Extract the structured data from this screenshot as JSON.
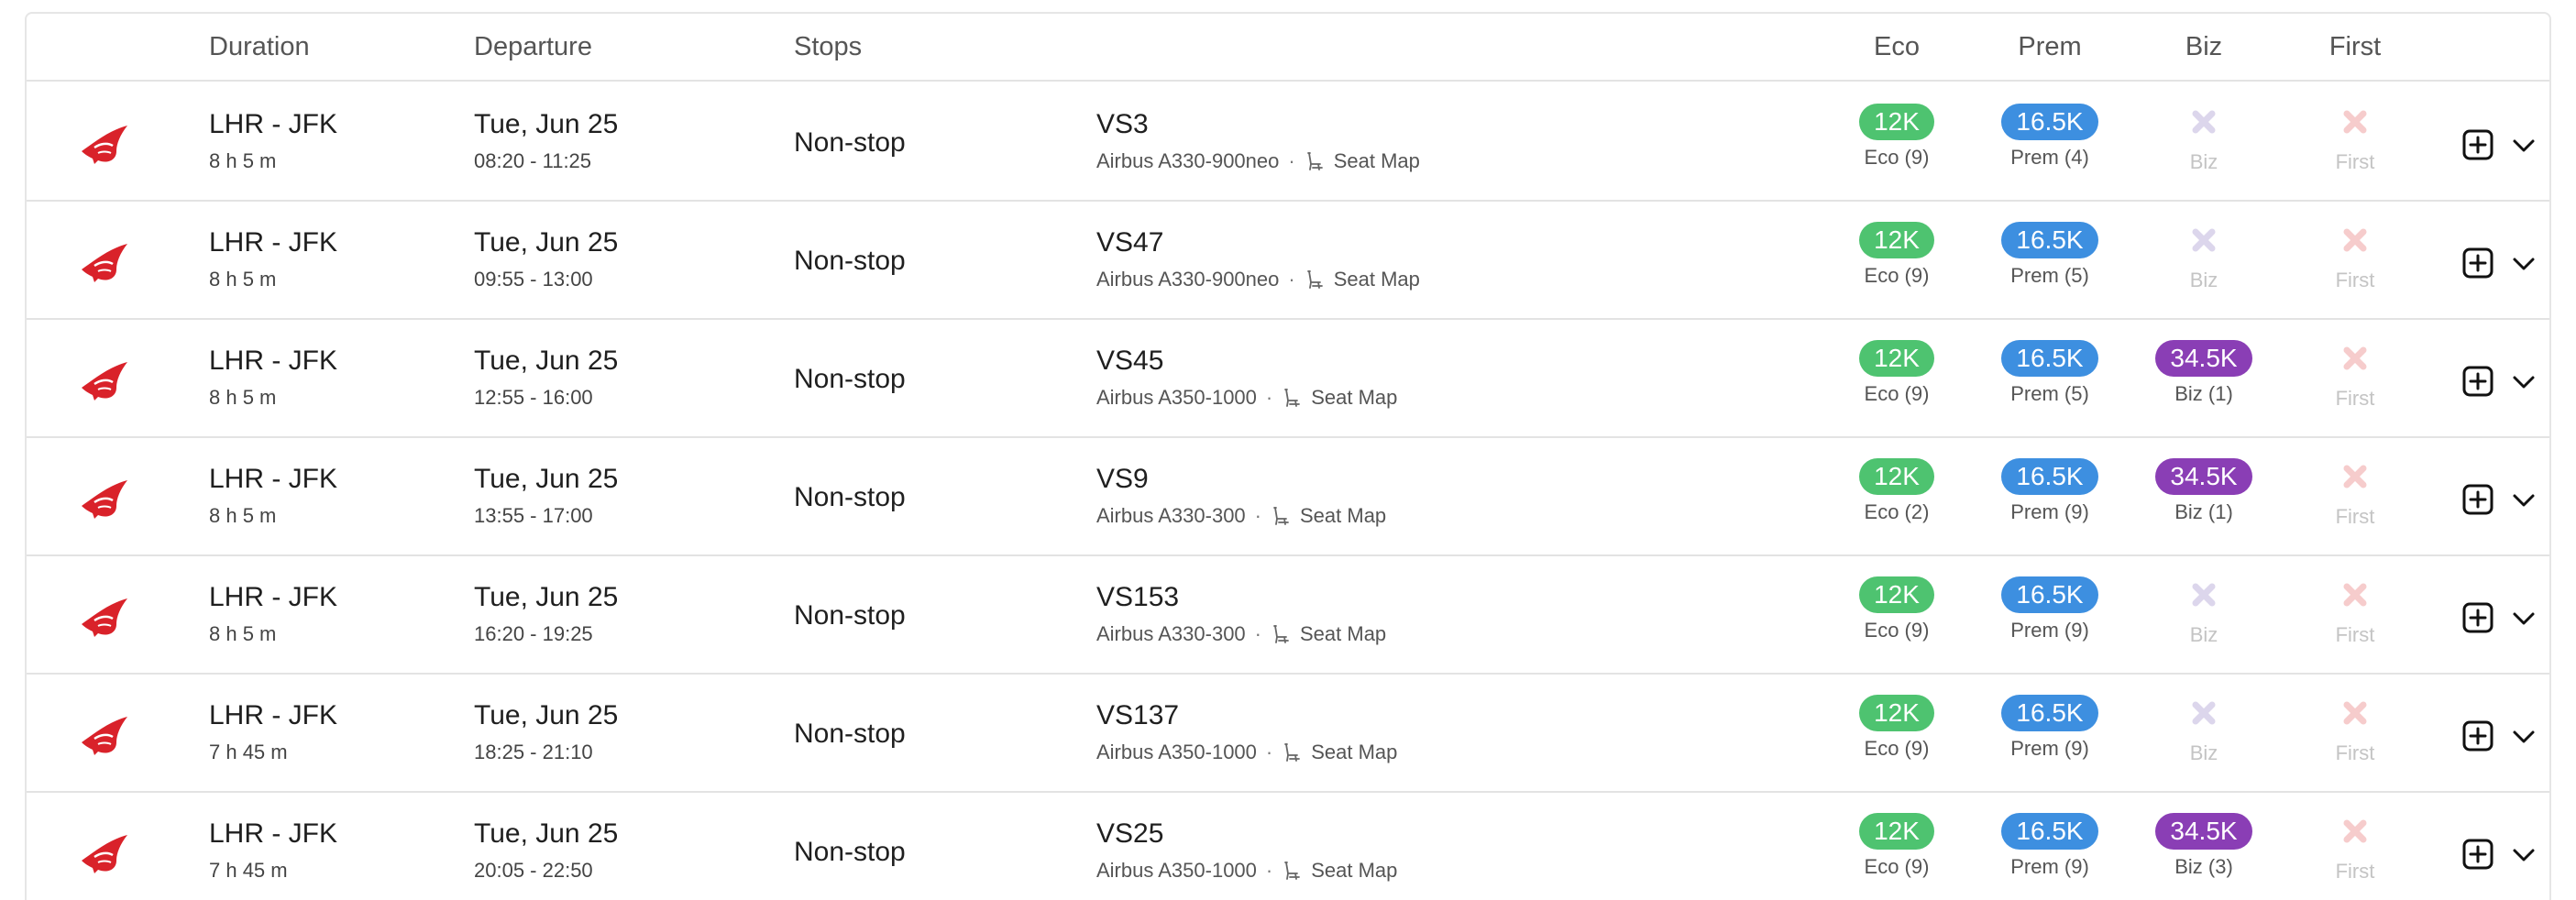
{
  "header": {
    "duration": "Duration",
    "departure": "Departure",
    "stops": "Stops",
    "eco": "Eco",
    "prem": "Prem",
    "biz": "Biz",
    "first": "First"
  },
  "colors": {
    "eco": "#4ec370",
    "prem": "#3d8fe0",
    "biz": "#8a3eb5",
    "airline_red": "#d9222a"
  },
  "icons": {
    "airline": "virgin-atlantic-logo",
    "seat": "seat-icon",
    "unavailable": "x-icon",
    "add": "plus-square-icon",
    "expand": "chevron-down-icon"
  },
  "rows": [
    {
      "route": "LHR - JFK",
      "duration": "8 h 5 m",
      "date": "Tue, Jun 25",
      "time": "08:20 - 11:25",
      "stops": "Non-stop",
      "flight": "VS3",
      "aircraft": "Airbus A330-900neo",
      "dot": "·",
      "seatmap": "Seat Map",
      "eco": {
        "price": "12K",
        "label": "Eco (9)",
        "available": true
      },
      "prem": {
        "price": "16.5K",
        "label": "Prem (4)",
        "available": true
      },
      "biz": {
        "price": "",
        "label": "Biz",
        "available": false
      },
      "first": {
        "price": "",
        "label": "First",
        "available": false
      }
    },
    {
      "route": "LHR - JFK",
      "duration": "8 h 5 m",
      "date": "Tue, Jun 25",
      "time": "09:55 - 13:00",
      "stops": "Non-stop",
      "flight": "VS47",
      "aircraft": "Airbus A330-900neo",
      "dot": "·",
      "seatmap": "Seat Map",
      "eco": {
        "price": "12K",
        "label": "Eco (9)",
        "available": true
      },
      "prem": {
        "price": "16.5K",
        "label": "Prem (5)",
        "available": true
      },
      "biz": {
        "price": "",
        "label": "Biz",
        "available": false
      },
      "first": {
        "price": "",
        "label": "First",
        "available": false
      }
    },
    {
      "route": "LHR - JFK",
      "duration": "8 h 5 m",
      "date": "Tue, Jun 25",
      "time": "12:55 - 16:00",
      "stops": "Non-stop",
      "flight": "VS45",
      "aircraft": "Airbus A350-1000",
      "dot": "·",
      "seatmap": "Seat Map",
      "eco": {
        "price": "12K",
        "label": "Eco (9)",
        "available": true
      },
      "prem": {
        "price": "16.5K",
        "label": "Prem (5)",
        "available": true
      },
      "biz": {
        "price": "34.5K",
        "label": "Biz (1)",
        "available": true
      },
      "first": {
        "price": "",
        "label": "First",
        "available": false
      }
    },
    {
      "route": "LHR - JFK",
      "duration": "8 h 5 m",
      "date": "Tue, Jun 25",
      "time": "13:55 - 17:00",
      "stops": "Non-stop",
      "flight": "VS9",
      "aircraft": "Airbus A330-300",
      "dot": "·",
      "seatmap": "Seat Map",
      "eco": {
        "price": "12K",
        "label": "Eco (2)",
        "available": true
      },
      "prem": {
        "price": "16.5K",
        "label": "Prem (9)",
        "available": true
      },
      "biz": {
        "price": "34.5K",
        "label": "Biz (1)",
        "available": true
      },
      "first": {
        "price": "",
        "label": "First",
        "available": false
      }
    },
    {
      "route": "LHR - JFK",
      "duration": "8 h 5 m",
      "date": "Tue, Jun 25",
      "time": "16:20 - 19:25",
      "stops": "Non-stop",
      "flight": "VS153",
      "aircraft": "Airbus A330-300",
      "dot": "·",
      "seatmap": "Seat Map",
      "eco": {
        "price": "12K",
        "label": "Eco (9)",
        "available": true
      },
      "prem": {
        "price": "16.5K",
        "label": "Prem (9)",
        "available": true
      },
      "biz": {
        "price": "",
        "label": "Biz",
        "available": false
      },
      "first": {
        "price": "",
        "label": "First",
        "available": false
      }
    },
    {
      "route": "LHR - JFK",
      "duration": "7 h 45 m",
      "date": "Tue, Jun 25",
      "time": "18:25 - 21:10",
      "stops": "Non-stop",
      "flight": "VS137",
      "aircraft": "Airbus A350-1000",
      "dot": "·",
      "seatmap": "Seat Map",
      "eco": {
        "price": "12K",
        "label": "Eco (9)",
        "available": true
      },
      "prem": {
        "price": "16.5K",
        "label": "Prem (9)",
        "available": true
      },
      "biz": {
        "price": "",
        "label": "Biz",
        "available": false
      },
      "first": {
        "price": "",
        "label": "First",
        "available": false
      }
    },
    {
      "route": "LHR - JFK",
      "duration": "7 h 45 m",
      "date": "Tue, Jun 25",
      "time": "20:05 - 22:50",
      "stops": "Non-stop",
      "flight": "VS25",
      "aircraft": "Airbus A350-1000",
      "dot": "·",
      "seatmap": "Seat Map",
      "eco": {
        "price": "12K",
        "label": "Eco (9)",
        "available": true
      },
      "prem": {
        "price": "16.5K",
        "label": "Prem (9)",
        "available": true
      },
      "biz": {
        "price": "34.5K",
        "label": "Biz (3)",
        "available": true
      },
      "first": {
        "price": "",
        "label": "First",
        "available": false
      }
    }
  ]
}
